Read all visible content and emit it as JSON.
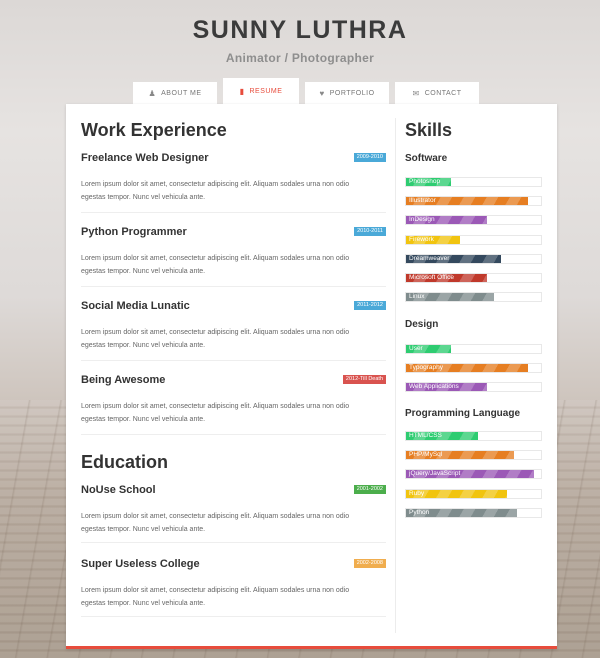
{
  "header": {
    "name": "SUNNY LUTHRA",
    "subtitle": "Animator / Photographer"
  },
  "tabs": [
    {
      "label": "ABOUT ME",
      "icon": "user-icon"
    },
    {
      "label": "RESUME",
      "icon": "document-icon",
      "active": true
    },
    {
      "label": "PORTFOLIO",
      "icon": "heart-icon"
    },
    {
      "label": "CONTACT",
      "icon": "envelope-icon"
    }
  ],
  "work": {
    "title": "Work Experience",
    "jobs": [
      {
        "title": "Freelance Web Designer",
        "years": "2009-2010",
        "color": "#4aa9d8",
        "desc": [
          "Lorem ipsum dolor sit amet, consectetur adipiscing elit. Aliquam sodales urna non odio",
          "egestas tempor. Nunc vel vehicula ante."
        ]
      },
      {
        "title": "Python Programmer",
        "years": "2010-2011",
        "color": "#4aa9d8",
        "desc": [
          "Lorem ipsum dolor sit amet, consectetur adipiscing elit. Aliquam sodales urna non odio",
          "egestas tempor. Nunc vel vehicula ante."
        ]
      },
      {
        "title": "Social Media Lunatic",
        "years": "2011-2012",
        "color": "#4aa9d8",
        "desc": [
          "Lorem ipsum dolor sit amet, consectetur adipiscing elit. Aliquam sodales urna non odio",
          "egestas tempor. Nunc vel vehicula ante."
        ]
      },
      {
        "title": "Being Awesome",
        "years": "2012-Till Death",
        "color": "#d9534f",
        "desc": [
          "Lorem ipsum dolor sit amet, consectetur adipiscing elit. Aliquam sodales urna non odio",
          "egestas tempor. Nunc vel vehicula ante."
        ]
      }
    ]
  },
  "education": {
    "title": "Education",
    "schools": [
      {
        "title": "NoUse School",
        "years": "2001-2002",
        "color": "#4cae4c",
        "desc": [
          "Lorem ipsum dolor sit amet, consectetur adipiscing elit. Aliquam sodales urna non odio",
          "egestas tempor. Nunc vel vehicula ante."
        ]
      },
      {
        "title": "Super Useless College",
        "years": "2002-2008",
        "color": "#f0ad4e",
        "desc": [
          "Lorem ipsum dolor sit amet, consectetur adipiscing elit. Aliquam sodales urna non odio",
          "egestas tempor. Nunc vel vehicula ante."
        ]
      }
    ]
  },
  "skills": {
    "title": "Skills",
    "groups": [
      {
        "name": "Software",
        "items": [
          {
            "label": "Photoshop",
            "level": 0.33,
            "color": "#2ecc71"
          },
          {
            "label": "Illustrator",
            "level": 0.9,
            "color": "#e67e22"
          },
          {
            "label": "InDesign",
            "level": 0.6,
            "color": "#9b59b6"
          },
          {
            "label": "Firework",
            "level": 0.4,
            "color": "#f1c40f"
          },
          {
            "label": "Dreamweaver",
            "level": 0.7,
            "color": "#34495e"
          },
          {
            "label": "Microsoft Office",
            "level": 0.6,
            "color": "#c0392b"
          },
          {
            "label": "Linux",
            "level": 0.65,
            "color": "#7f8c8d"
          }
        ]
      },
      {
        "name": "Design",
        "items": [
          {
            "label": "User",
            "level": 0.33,
            "color": "#2ecc71"
          },
          {
            "label": "Typography",
            "level": 0.9,
            "color": "#e67e22"
          },
          {
            "label": "Web Applications",
            "level": 0.6,
            "color": "#9b59b6"
          }
        ]
      },
      {
        "name": "Programming Language",
        "items": [
          {
            "label": "HTML/CSS",
            "level": 0.53,
            "color": "#2ecc71"
          },
          {
            "label": "PHP/MySql",
            "level": 0.8,
            "color": "#e67e22"
          },
          {
            "label": "jQuery/JavaScript",
            "level": 0.95,
            "color": "#9b59b6"
          },
          {
            "label": "Ruby",
            "level": 0.75,
            "color": "#f1c40f"
          },
          {
            "label": "Python",
            "level": 0.82,
            "color": "#7f8c8d"
          }
        ]
      }
    ]
  }
}
